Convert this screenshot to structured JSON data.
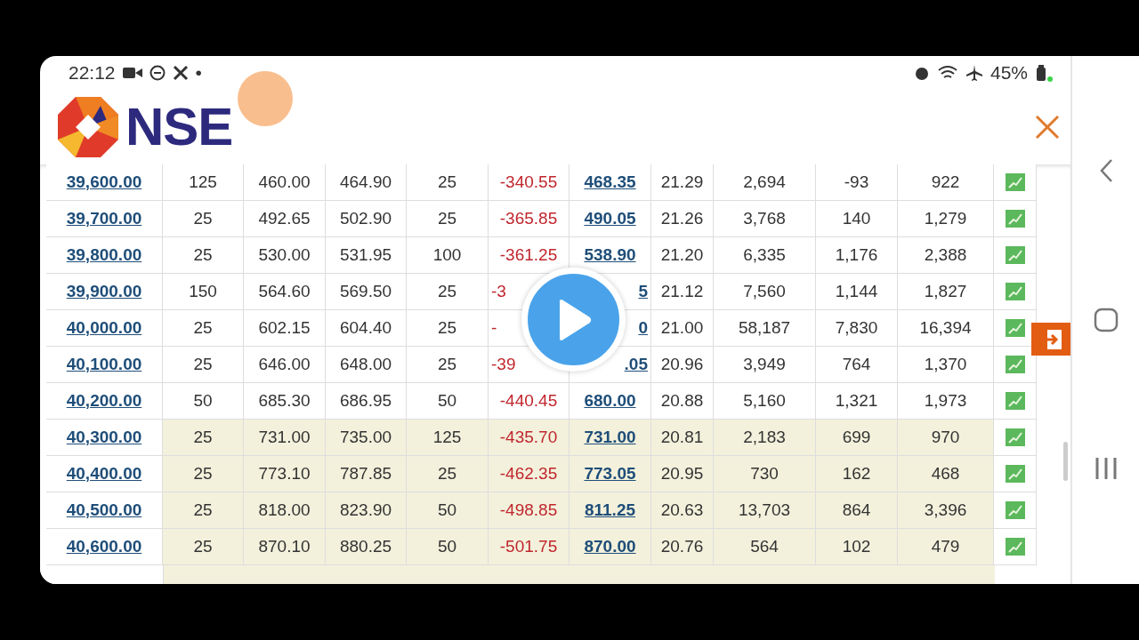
{
  "status_bar": {
    "time": "22:12",
    "dot": "•",
    "battery_percent": "45%"
  },
  "header": {
    "logo_text": "NSE"
  },
  "table": {
    "rows": [
      {
        "strike": "39,600.00",
        "cells": [
          "125",
          "460.00",
          "464.90",
          "25",
          "-340.55",
          "468.35",
          "21.29",
          "2,694",
          "-93",
          "922"
        ],
        "shaded": false,
        "covered": false
      },
      {
        "strike": "39,700.00",
        "cells": [
          "25",
          "492.65",
          "502.90",
          "25",
          "-365.85",
          "490.05",
          "21.26",
          "3,768",
          "140",
          "1,279"
        ],
        "shaded": false,
        "covered": false
      },
      {
        "strike": "39,800.00",
        "cells": [
          "25",
          "530.00",
          "531.95",
          "100",
          "-361.25",
          "538.90",
          "21.20",
          "6,335",
          "1,176",
          "2,388"
        ],
        "shaded": false,
        "covered": false
      },
      {
        "strike": "39,900.00",
        "cells": [
          "150",
          "564.60",
          "569.50",
          "25",
          "-3",
          "5",
          "21.12",
          "7,560",
          "1,144",
          "1,827"
        ],
        "shaded": false,
        "covered": true
      },
      {
        "strike": "40,000.00",
        "cells": [
          "25",
          "602.15",
          "604.40",
          "25",
          "-",
          "0",
          "21.00",
          "58,187",
          "7,830",
          "16,394"
        ],
        "shaded": false,
        "covered": true
      },
      {
        "strike": "40,100.00",
        "cells": [
          "25",
          "646.00",
          "648.00",
          "25",
          "-39",
          ".05",
          "20.96",
          "3,949",
          "764",
          "1,370"
        ],
        "shaded": false,
        "covered": true
      },
      {
        "strike": "40,200.00",
        "cells": [
          "50",
          "685.30",
          "686.95",
          "50",
          "-440.45",
          "680.00",
          "20.88",
          "5,160",
          "1,321",
          "1,973"
        ],
        "shaded": false,
        "covered": false
      },
      {
        "strike": "40,300.00",
        "cells": [
          "25",
          "731.00",
          "735.00",
          "125",
          "-435.70",
          "731.00",
          "20.81",
          "2,183",
          "699",
          "970"
        ],
        "shaded": true,
        "covered": false
      },
      {
        "strike": "40,400.00",
        "cells": [
          "25",
          "773.10",
          "787.85",
          "25",
          "-462.35",
          "773.05",
          "20.95",
          "730",
          "162",
          "468"
        ],
        "shaded": true,
        "covered": false
      },
      {
        "strike": "40,500.00",
        "cells": [
          "25",
          "818.00",
          "823.90",
          "50",
          "-498.85",
          "811.25",
          "20.63",
          "13,703",
          "864",
          "3,396"
        ],
        "shaded": true,
        "covered": false
      },
      {
        "strike": "40,600.00",
        "cells": [
          "25",
          "870.10",
          "880.25",
          "50",
          "-501.75",
          "870.00",
          "20.76",
          "564",
          "102",
          "479"
        ],
        "shaded": true,
        "covered": false
      }
    ]
  }
}
